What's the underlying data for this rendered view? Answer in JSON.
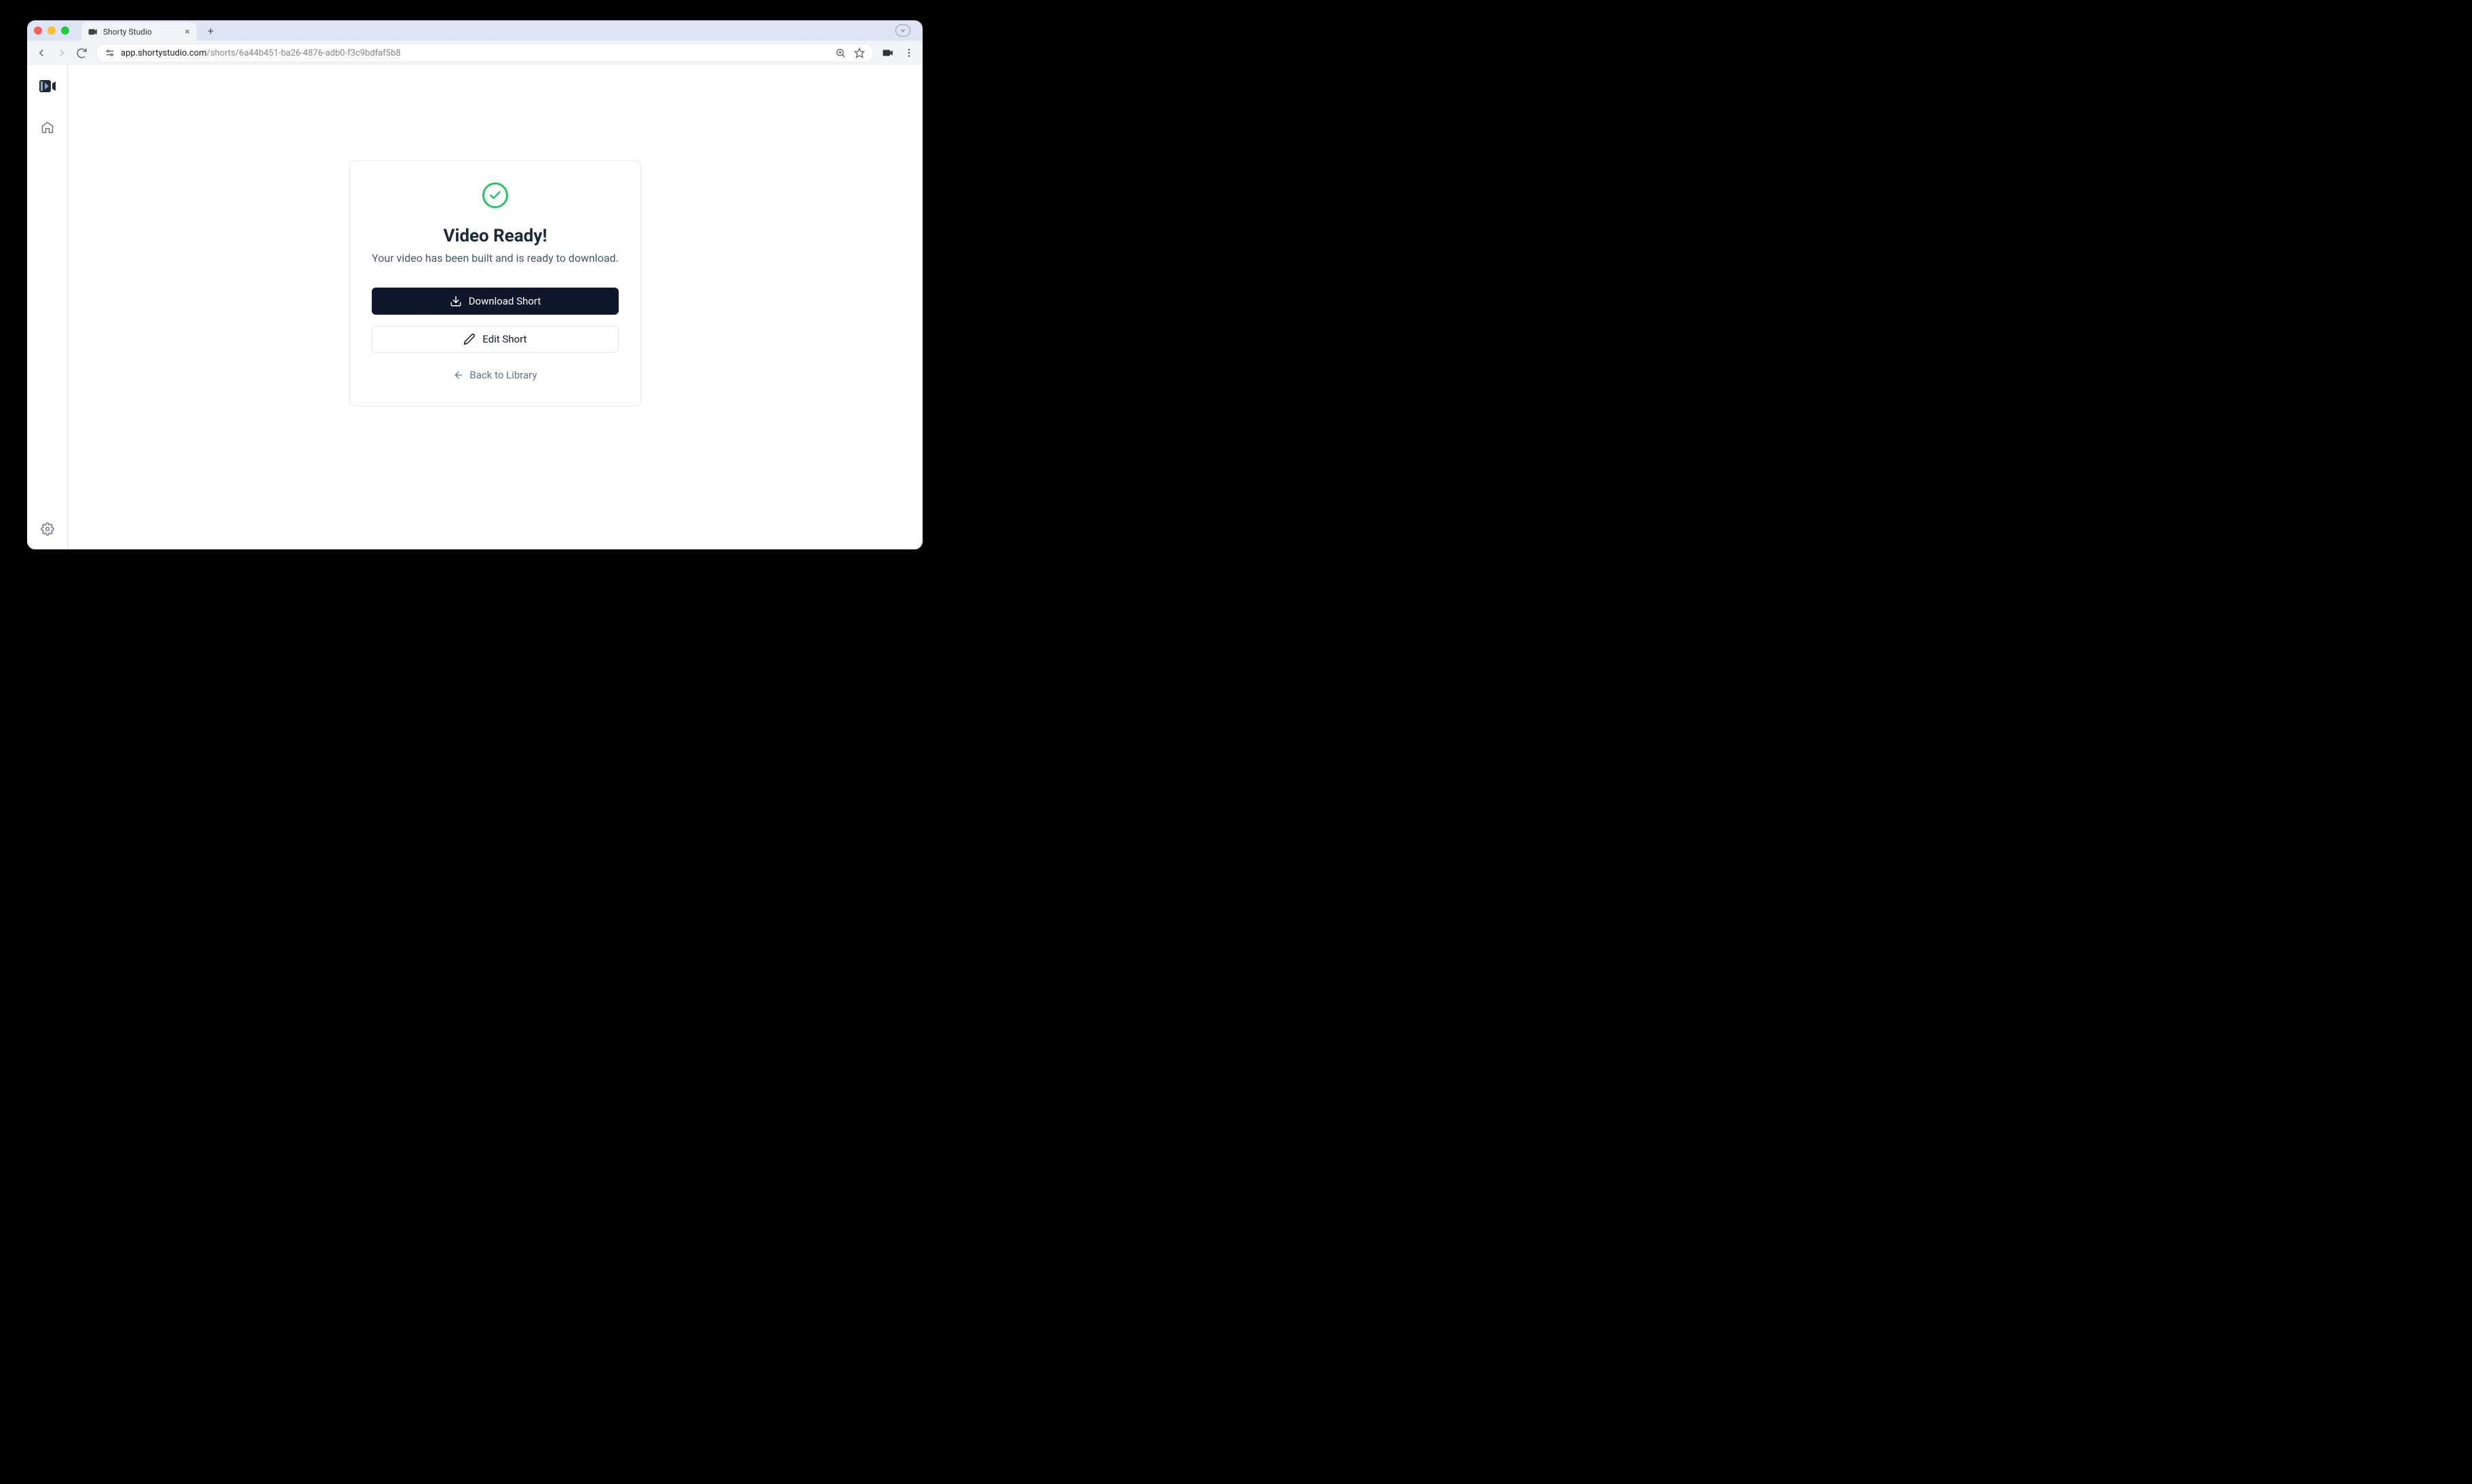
{
  "browser": {
    "tab_title": "Shorty Studio",
    "url_domain": "app.shortystudio.com",
    "url_path": "/shorts/6a44b451-ba26-4876-adb0-f3c9bdfaf5b8"
  },
  "card": {
    "title": "Video Ready!",
    "subtitle": "Your video has been built and is ready to download.",
    "download_label": "Download Short",
    "edit_label": "Edit Short",
    "back_label": "Back to Library"
  }
}
